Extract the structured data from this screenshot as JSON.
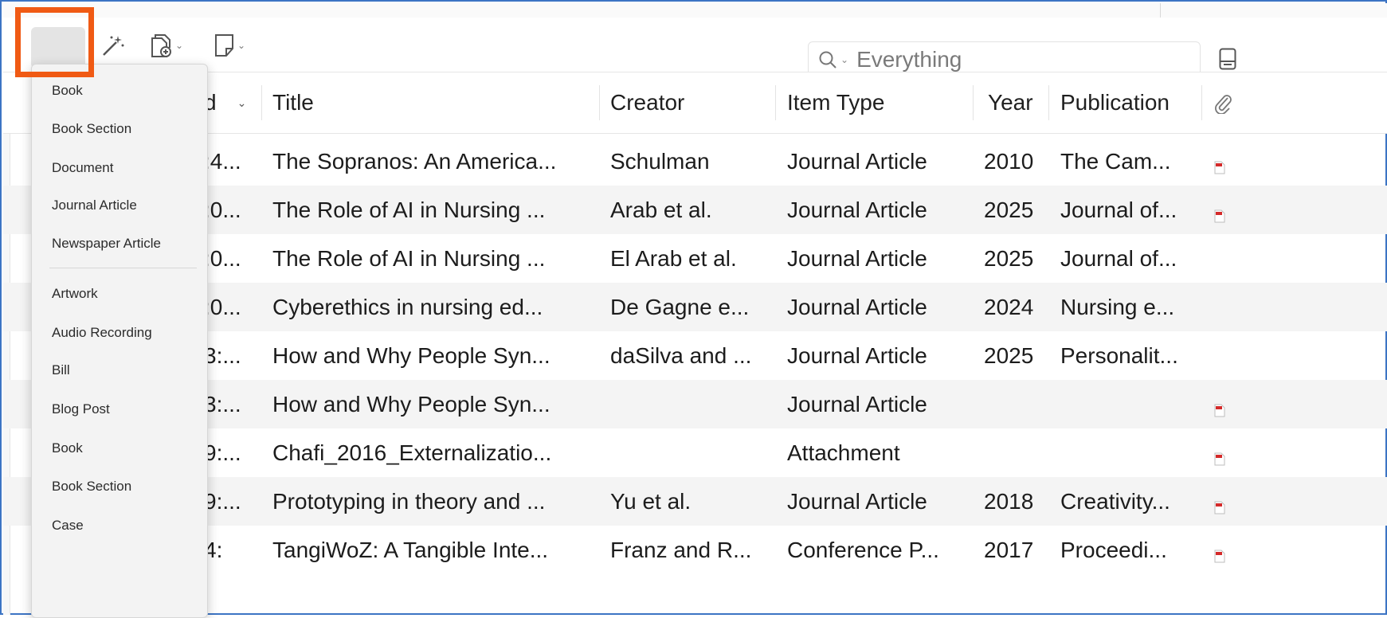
{
  "toolbar": {
    "buttons": [
      {
        "icon": "new-item-icon",
        "has_dropdown": true
      },
      {
        "icon": "magic-wand-icon",
        "has_dropdown": false
      },
      {
        "icon": "add-attachment-icon",
        "has_dropdown": true
      },
      {
        "icon": "new-note-icon",
        "has_dropdown": true
      }
    ],
    "search": {
      "placeholder": "Everything",
      "mode_icon": "search-icon"
    },
    "pane_toggle_icon": "item-pane-toggle-icon"
  },
  "columns": {
    "date_added_fragment": "d",
    "title": "Title",
    "creator": "Creator",
    "item_type": "Item Type",
    "year": "Year",
    "publication": "Publication",
    "attachments_icon": "paperclip-icon"
  },
  "rows": [
    {
      "date_fragment": ":4...",
      "title": "The Sopranos: An America...",
      "creator": "Schulman",
      "item_type": "Journal Article",
      "year": "2010",
      "publication": "The Cam...",
      "pdf": true
    },
    {
      "date_fragment": ":0...",
      "title": "The Role of AI in Nursing ...",
      "creator": "Arab et al.",
      "item_type": "Journal Article",
      "year": "2025",
      "publication": "Journal of...",
      "pdf": true
    },
    {
      "date_fragment": ":0...",
      "title": "The Role of AI in Nursing ...",
      "creator": "El Arab et al.",
      "item_type": "Journal Article",
      "year": "2025",
      "publication": "Journal of...",
      "pdf": false
    },
    {
      "date_fragment": ":0...",
      "title": "Cyberethics in nursing ed...",
      "creator": "De Gagne e...",
      "item_type": "Journal Article",
      "year": "2024",
      "publication": "Nursing e...",
      "pdf": false
    },
    {
      "date_fragment": "3:...",
      "title": "How and Why People Syn...",
      "creator": "daSilva and ...",
      "item_type": "Journal Article",
      "year": "2025",
      "publication": "Personalit...",
      "pdf": false
    },
    {
      "date_fragment": "3:...",
      "title": "How and Why People Syn...",
      "creator": "",
      "item_type": "Journal Article",
      "year": "",
      "publication": "",
      "pdf": true
    },
    {
      "date_fragment": "9:...",
      "title": "Chafi_2016_Externalizatio...",
      "creator": "",
      "item_type": "Attachment",
      "year": "",
      "publication": "",
      "pdf": true
    },
    {
      "date_fragment": "9:...",
      "title": "Prototyping in theory and ...",
      "creator": "Yu et al.",
      "item_type": "Journal Article",
      "year": "2018",
      "publication": "Creativity...",
      "pdf": true
    },
    {
      "date_fragment": "4:",
      "title": "TangiWoZ: A Tangible Inte...",
      "creator": "Franz and R...",
      "item_type": "Conference P...",
      "year": "2017",
      "publication": "Proceedi...",
      "pdf": true
    }
  ],
  "new_item_menu": {
    "recent": [
      "Book",
      "Book Section",
      "Document",
      "Journal Article",
      "Newspaper Article"
    ],
    "all": [
      "Artwork",
      "Audio Recording",
      "Bill",
      "Blog Post",
      "Book",
      "Book Section",
      "Case"
    ]
  },
  "colors": {
    "highlight": "#f05a14",
    "pdf_red": "#d42a2a",
    "frame": "#3c74c4"
  }
}
